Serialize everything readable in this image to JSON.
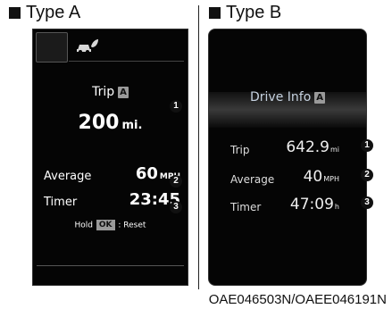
{
  "type_a": {
    "heading": "Type A",
    "trip_label": "Trip",
    "trip_mode_badge": "A",
    "trip_value": "200",
    "trip_unit": "mi.",
    "average_label": "Average",
    "average_value": "60",
    "average_unit": "MPH",
    "timer_label": "Timer",
    "timer_value": "23:45",
    "hold_prefix": "Hold",
    "hold_key": "OK",
    "hold_suffix": ": Reset",
    "icon": "eco-car-icon"
  },
  "type_b": {
    "heading": "Type B",
    "title": "Drive Info",
    "title_badge": "A",
    "trip_label": "Trip",
    "trip_value": "642.9",
    "trip_unit": "mi",
    "average_label": "Average",
    "average_value": "40",
    "average_unit": "MPH",
    "timer_label": "Timer",
    "timer_value": "47:09",
    "timer_unit": "h"
  },
  "callouts": [
    "1",
    "2",
    "3"
  ],
  "footer_code": "OAE046503N/OAEE046191N"
}
